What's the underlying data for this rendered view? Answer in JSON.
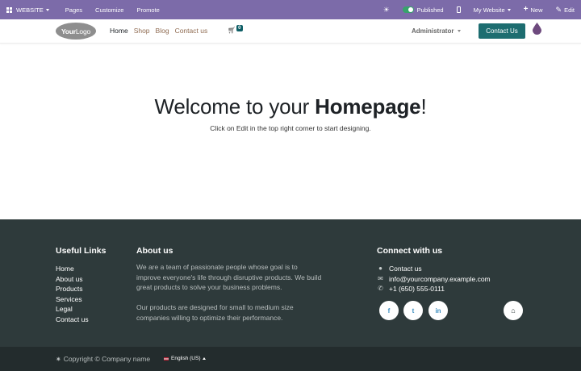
{
  "adminbar": {
    "app_menu": "WEBSITE",
    "menu": [
      "Pages",
      "Customize",
      "Promote"
    ],
    "published": "Published",
    "website_switcher": "My Website",
    "new": "New",
    "edit": "Edit"
  },
  "navbar": {
    "logo_bold": "Your",
    "logo_rest": "Logo",
    "links": [
      "Home",
      "Shop",
      "Blog",
      "Contact us"
    ],
    "active_link": "Home",
    "cart_count": "0",
    "user": "Administrator",
    "cta": "Contact Us"
  },
  "hero": {
    "title_plain": "Welcome to your ",
    "title_bold": "Homepage",
    "title_end": "!",
    "subtitle": "Click on Edit in the top right corner to start designing."
  },
  "footer": {
    "useful_links_title": "Useful Links",
    "useful_links": [
      "Home",
      "About us",
      "Products",
      "Services",
      "Legal",
      "Contact us"
    ],
    "about_title": "About us",
    "about_p1": "We are a team of passionate people whose goal is to improve everyone's life through disruptive products. We build great products to solve your business problems.",
    "about_p2": "Our products are designed for small to medium size companies willing to optimize their performance.",
    "connect_title": "Connect with us",
    "contact_label": "Contact us",
    "email": "info@yourcompany.example.com",
    "phone": "+1 (650) 555-0111",
    "social": [
      {
        "name": "facebook-icon",
        "glyph": "f"
      },
      {
        "name": "twitter-icon",
        "glyph": "t"
      },
      {
        "name": "linkedin-icon",
        "glyph": "in"
      },
      {
        "name": "home-icon",
        "glyph": "⌂"
      }
    ]
  },
  "copyright": {
    "text": "Copyright © Company name",
    "language": "English (US)"
  },
  "colors": {
    "adminbar": "#7c6ba9",
    "cta": "#1d6d70",
    "footer": "#2e3a3b",
    "copyright_bar": "#232c2d",
    "link": "#8f6b51"
  }
}
